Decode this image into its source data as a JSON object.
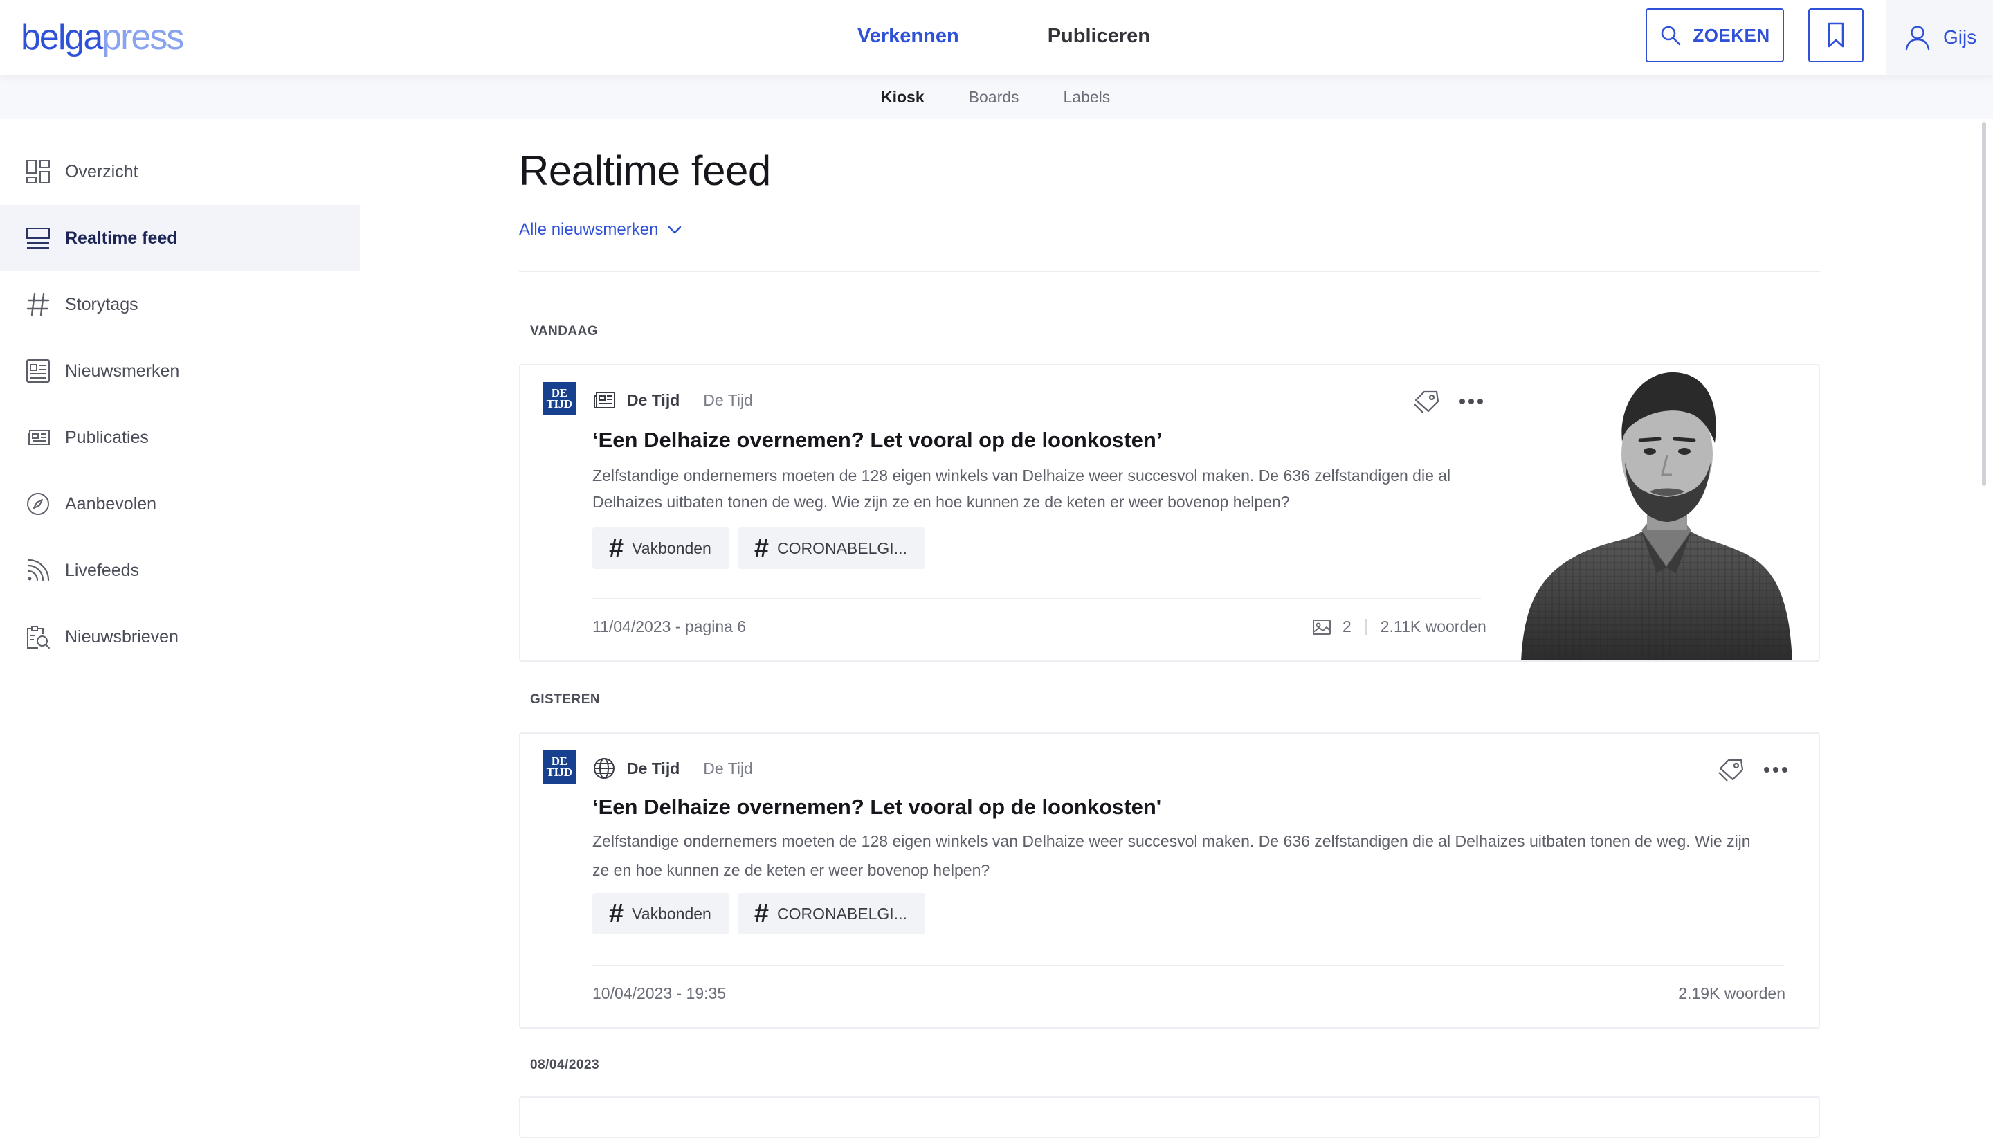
{
  "logo": {
    "part1": "belga",
    "part2": "press"
  },
  "nav": {
    "explore": "Verkennen",
    "publish": "Publiceren"
  },
  "search": {
    "label": "ZOEKEN"
  },
  "user": {
    "name": "Gijs"
  },
  "subnav": {
    "items": [
      "Kiosk",
      "Boards",
      "Labels"
    ]
  },
  "sidebar": {
    "items": [
      {
        "label": "Overzicht",
        "icon": "dashboard-icon"
      },
      {
        "label": "Realtime feed",
        "icon": "feed-icon"
      },
      {
        "label": "Storytags",
        "icon": "hashtag-icon"
      },
      {
        "label": "Nieuwsmerken",
        "icon": "newspaper-brand-icon"
      },
      {
        "label": "Publicaties",
        "icon": "publication-icon"
      },
      {
        "label": "Aanbevolen",
        "icon": "compass-icon"
      },
      {
        "label": "Livefeeds",
        "icon": "rss-icon"
      },
      {
        "label": "Nieuwsbrieven",
        "icon": "newsletter-search-icon"
      }
    ]
  },
  "page": {
    "title": "Realtime feed",
    "filter": "Alle nieuwsmerken"
  },
  "groups": [
    "VANDAAG",
    "GISTEREN",
    "08/04/2023"
  ],
  "articles": [
    {
      "logo_line1": "DE",
      "logo_line2": "TIJD",
      "source_icon": "newspaper-icon",
      "brand": "De Tijd",
      "publication": "De Tijd",
      "title": "‘Een Delhaize overnemen? Let vooral op de loonkosten’",
      "desc_line1": "Zelfstandige ondernemers moeten de 128 eigen winkels van Delhaize weer succesvol maken. De 636 zelfstandigen die al",
      "desc_line2": "Delhaizes uitbaten tonen de weg. Wie zijn ze en hoe kunnen ze de keten er weer bovenop helpen?",
      "tags": [
        "Vakbonden",
        "CORONABELGI..."
      ],
      "date": "11/04/2023 - pagina 6",
      "images": "2",
      "words": "2.11K woorden"
    },
    {
      "logo_line1": "DE",
      "logo_line2": "TIJD",
      "source_icon": "globe-icon",
      "brand": "De Tijd",
      "publication": "De Tijd",
      "title": "‘Een Delhaize overnemen? Let vooral op de loonkosten'",
      "desc_line1": "Zelfstandige ondernemers moeten de 128 eigen winkels van Delhaize weer succesvol maken. De 636 zelfstandigen die al Delhaizes uitbaten tonen de weg. Wie zijn",
      "desc_line2": "ze en hoe kunnen ze de keten er weer bovenop helpen?",
      "tags": [
        "Vakbonden",
        "CORONABELGI..."
      ],
      "date": "10/04/2023 - 19:35",
      "words": "2.19K woorden"
    }
  ],
  "colors": {
    "accent": "#2f51d8",
    "brand_logo": "#17418f",
    "sidebar_active": "#f3f4f9"
  }
}
